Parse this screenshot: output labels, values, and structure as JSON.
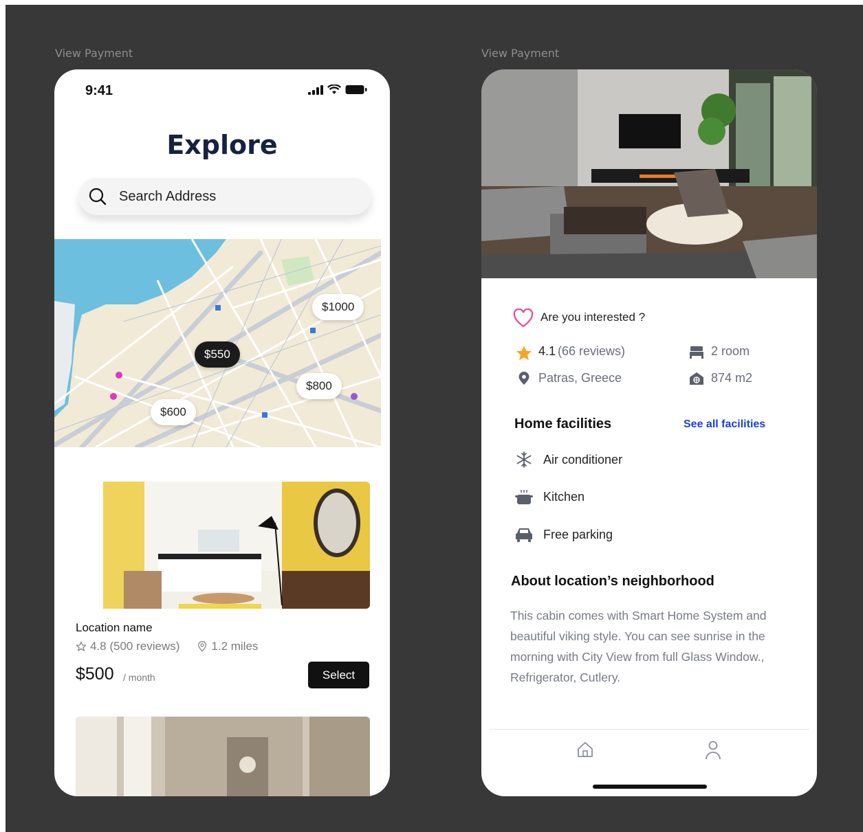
{
  "frames": [
    {
      "label": "View Payment"
    },
    {
      "label": "View Payment"
    }
  ],
  "explore": {
    "status_time": "9:41",
    "title": "Explore",
    "search": {
      "placeholder": "Search Address"
    },
    "map_pins": [
      {
        "label": "$1000",
        "active": false
      },
      {
        "label": "$550",
        "active": true
      },
      {
        "label": "$800",
        "active": false
      },
      {
        "label": "$600",
        "active": false
      }
    ],
    "card": {
      "name": "Location name",
      "rating": "4.8 (500 reviews)",
      "distance": "1.2 miles",
      "price": "$500",
      "price_unit": "/ month",
      "select_label": "Select"
    }
  },
  "details": {
    "interest_label": "Are you interested ?",
    "rating_value": "4.1",
    "rating_reviews": "(66 reviews)",
    "rooms": "2 room",
    "location": "Patras, Greece",
    "area": "874 m2",
    "facilities_title": "Home facilities",
    "see_all_label": "See all facilities",
    "facilities": [
      {
        "icon": "snowflake-icon",
        "label": "Air conditioner"
      },
      {
        "icon": "pot-icon",
        "label": "Kitchen"
      },
      {
        "icon": "car-icon",
        "label": "Free parking"
      }
    ],
    "about_title": "About location’s neighborhood",
    "about_text": "This cabin comes with Smart Home System and beautiful viking style. You can see sunrise in the morning with City View from full Glass Window., Refrigerator, Cutlery."
  },
  "colors": {
    "accent_heart": "#e8489a",
    "link": "#1a3fd8",
    "star": "#f5a524",
    "dark_navy": "#16233f"
  }
}
